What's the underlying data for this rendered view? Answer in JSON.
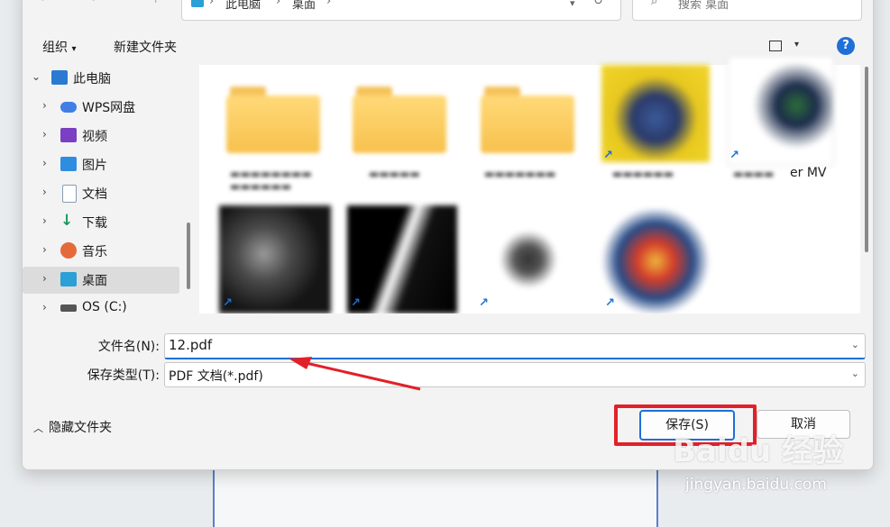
{
  "address": {
    "crumbs": [
      "此电脑",
      "桌面"
    ]
  },
  "search": {
    "placeholder": "搜索 桌面"
  },
  "toolbar": {
    "organize": "组织",
    "new_folder": "新建文件夹",
    "help": "?"
  },
  "sidebar": {
    "items": [
      {
        "label": "此电脑",
        "icon": "pc-icon",
        "color": "#2a7ad1"
      },
      {
        "label": "WPS网盘",
        "icon": "cloud-icon",
        "color": "#3f7fe6"
      },
      {
        "label": "视频",
        "icon": "video-icon",
        "color": "#7a3fc2"
      },
      {
        "label": "图片",
        "icon": "image-icon",
        "color": "#2f8de0"
      },
      {
        "label": "文档",
        "icon": "document-icon",
        "color": "#8a9bb0"
      },
      {
        "label": "下载",
        "icon": "download-icon",
        "color": "#1b9a62"
      },
      {
        "label": "音乐",
        "icon": "music-icon",
        "color": "#e46a3a"
      },
      {
        "label": "桌面",
        "icon": "desktop-icon",
        "color": "#2aa0d6"
      },
      {
        "label": "OS (C:)",
        "icon": "drive-icon",
        "color": "#555555"
      }
    ]
  },
  "files": {
    "visible_partial_label": "er MV"
  },
  "form": {
    "filename_label": "文件名(N):",
    "filename_value": "12.pdf",
    "type_label": "保存类型(T):",
    "type_value": "PDF 文档(*.pdf)"
  },
  "footer": {
    "hide_folders": "隐藏文件夹",
    "save": "保存(S)",
    "cancel": "取消"
  },
  "watermark": {
    "brand": "Baidu 经验",
    "url": "jingyan.baidu.com"
  },
  "colors": {
    "accent": "#1f6fd8",
    "annotation": "#e2202a"
  }
}
